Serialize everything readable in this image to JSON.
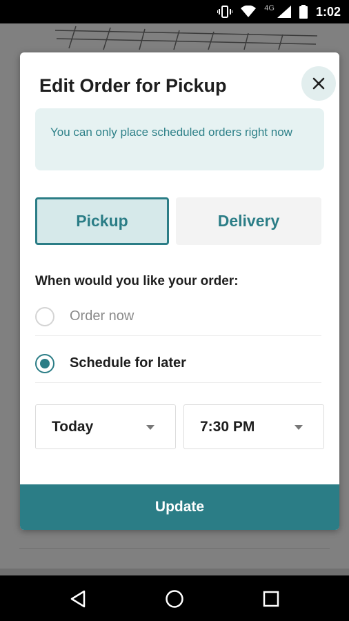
{
  "status_bar": {
    "network": "4G",
    "time": "1:02",
    "icons": [
      "vibrate-icon",
      "wifi-icon",
      "signal-icon",
      "battery-icon"
    ]
  },
  "modal": {
    "title": "Edit Order for Pickup",
    "close_icon": "close-icon",
    "notice": "You can only place scheduled orders right now",
    "modes": [
      {
        "label": "Pickup",
        "selected": true
      },
      {
        "label": "Delivery",
        "selected": false
      }
    ],
    "question": "When would you like your order:",
    "options": [
      {
        "label": "Order now",
        "checked": false
      },
      {
        "label": "Schedule for later",
        "checked": true
      }
    ],
    "day_select": {
      "value": "Today"
    },
    "time_select": {
      "value": "7:30 PM"
    },
    "update_label": "Update"
  },
  "colors": {
    "accent": "#2b7d86",
    "notice_bg": "#e6f2f2",
    "selected_mode_bg": "#d6e9ea"
  },
  "nav_bar": {
    "icons": [
      "back-icon",
      "home-icon",
      "recents-icon"
    ]
  }
}
